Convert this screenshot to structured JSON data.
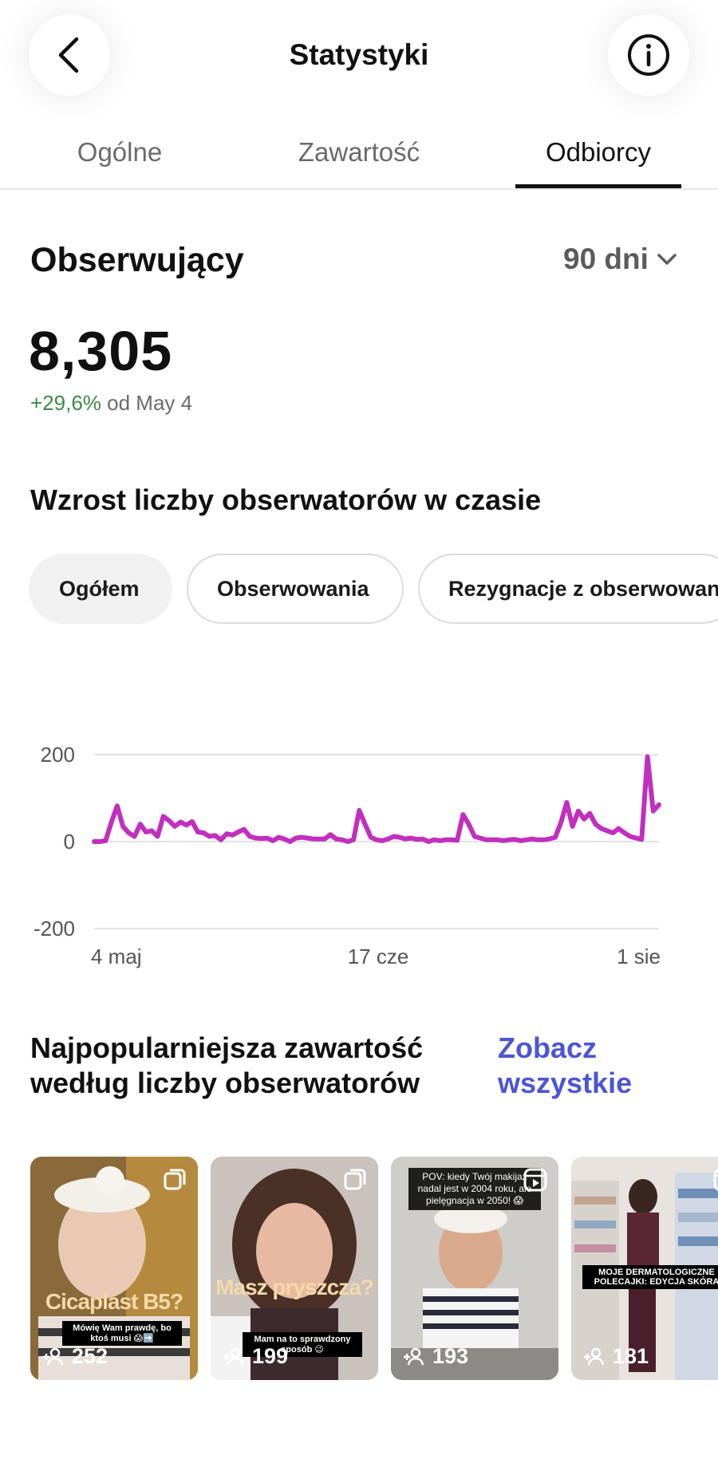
{
  "header": {
    "title": "Statystyki",
    "back_icon": "chevron-left-icon",
    "info_icon": "info-icon"
  },
  "tabs": [
    {
      "label": "Ogólne",
      "active": false
    },
    {
      "label": "Zawartość",
      "active": false
    },
    {
      "label": "Odbiorcy",
      "active": true
    }
  ],
  "followers": {
    "title": "Obserwujący",
    "range_label": "90 dni",
    "count": "8,305",
    "delta_pct": "+29,6%",
    "delta_since": "od May 4"
  },
  "growth": {
    "title": "Wzrost liczby obserwatorów w czasie",
    "chips": [
      {
        "label": "Ogółem",
        "active": true
      },
      {
        "label": "Obserwowania",
        "active": false
      },
      {
        "label": "Rezygnacje z obserwowania",
        "active": false
      }
    ]
  },
  "chart_data": {
    "type": "line",
    "title": "",
    "xlabel": "",
    "ylabel": "",
    "ylim": [
      -200,
      200
    ],
    "yticks": [
      "200",
      "0",
      "-200"
    ],
    "xticks": [
      "4 maj",
      "17 cze",
      "1 sie"
    ],
    "grid": true,
    "color": "#c12fbe",
    "values": [
      0,
      0,
      2,
      45,
      82,
      35,
      20,
      12,
      40,
      22,
      25,
      12,
      58,
      48,
      35,
      45,
      38,
      46,
      22,
      20,
      12,
      14,
      4,
      18,
      15,
      22,
      28,
      12,
      8,
      7,
      8,
      2,
      10,
      6,
      0,
      8,
      10,
      8,
      6,
      6,
      6,
      16,
      6,
      4,
      0,
      4,
      72,
      40,
      10,
      4,
      2,
      6,
      12,
      10,
      6,
      8,
      5,
      6,
      0,
      4,
      2,
      4,
      4,
      3,
      62,
      40,
      12,
      8,
      4,
      4,
      4,
      2,
      4,
      5,
      2,
      4,
      6,
      4,
      4,
      6,
      10,
      44,
      90,
      35,
      70,
      52,
      65,
      40,
      30,
      25,
      20,
      30,
      20,
      12,
      8,
      5,
      195,
      70,
      85
    ]
  },
  "top_content": {
    "title": "Najpopularniejsza zawartość według liczby obserwatorów",
    "see_all": "Zobacz wszystkie",
    "items": [
      {
        "overlay": "Cicaplast B5?",
        "caption": "Mówię Wam prawdę, bo ktoś musi 😱➡️",
        "count": "252",
        "type_icon": "carousel-icon"
      },
      {
        "overlay": "Masz pryszcza?",
        "caption": "Mam na to sprawdzony sposób 😉",
        "count": "199",
        "type_icon": "carousel-icon"
      },
      {
        "overlay": "",
        "caption": "POV: kiedy Twój makijaż nadal jest w 2004 roku, ale pielęgnacja w 2050! 😱",
        "count": "193",
        "type_icon": "reel-icon"
      },
      {
        "overlay": "",
        "caption": "MOJE DERMATOLOGICZNE POLECAJKI: EDYCJA SKÓRA",
        "count": "181",
        "type_icon": "reel-icon"
      }
    ]
  }
}
